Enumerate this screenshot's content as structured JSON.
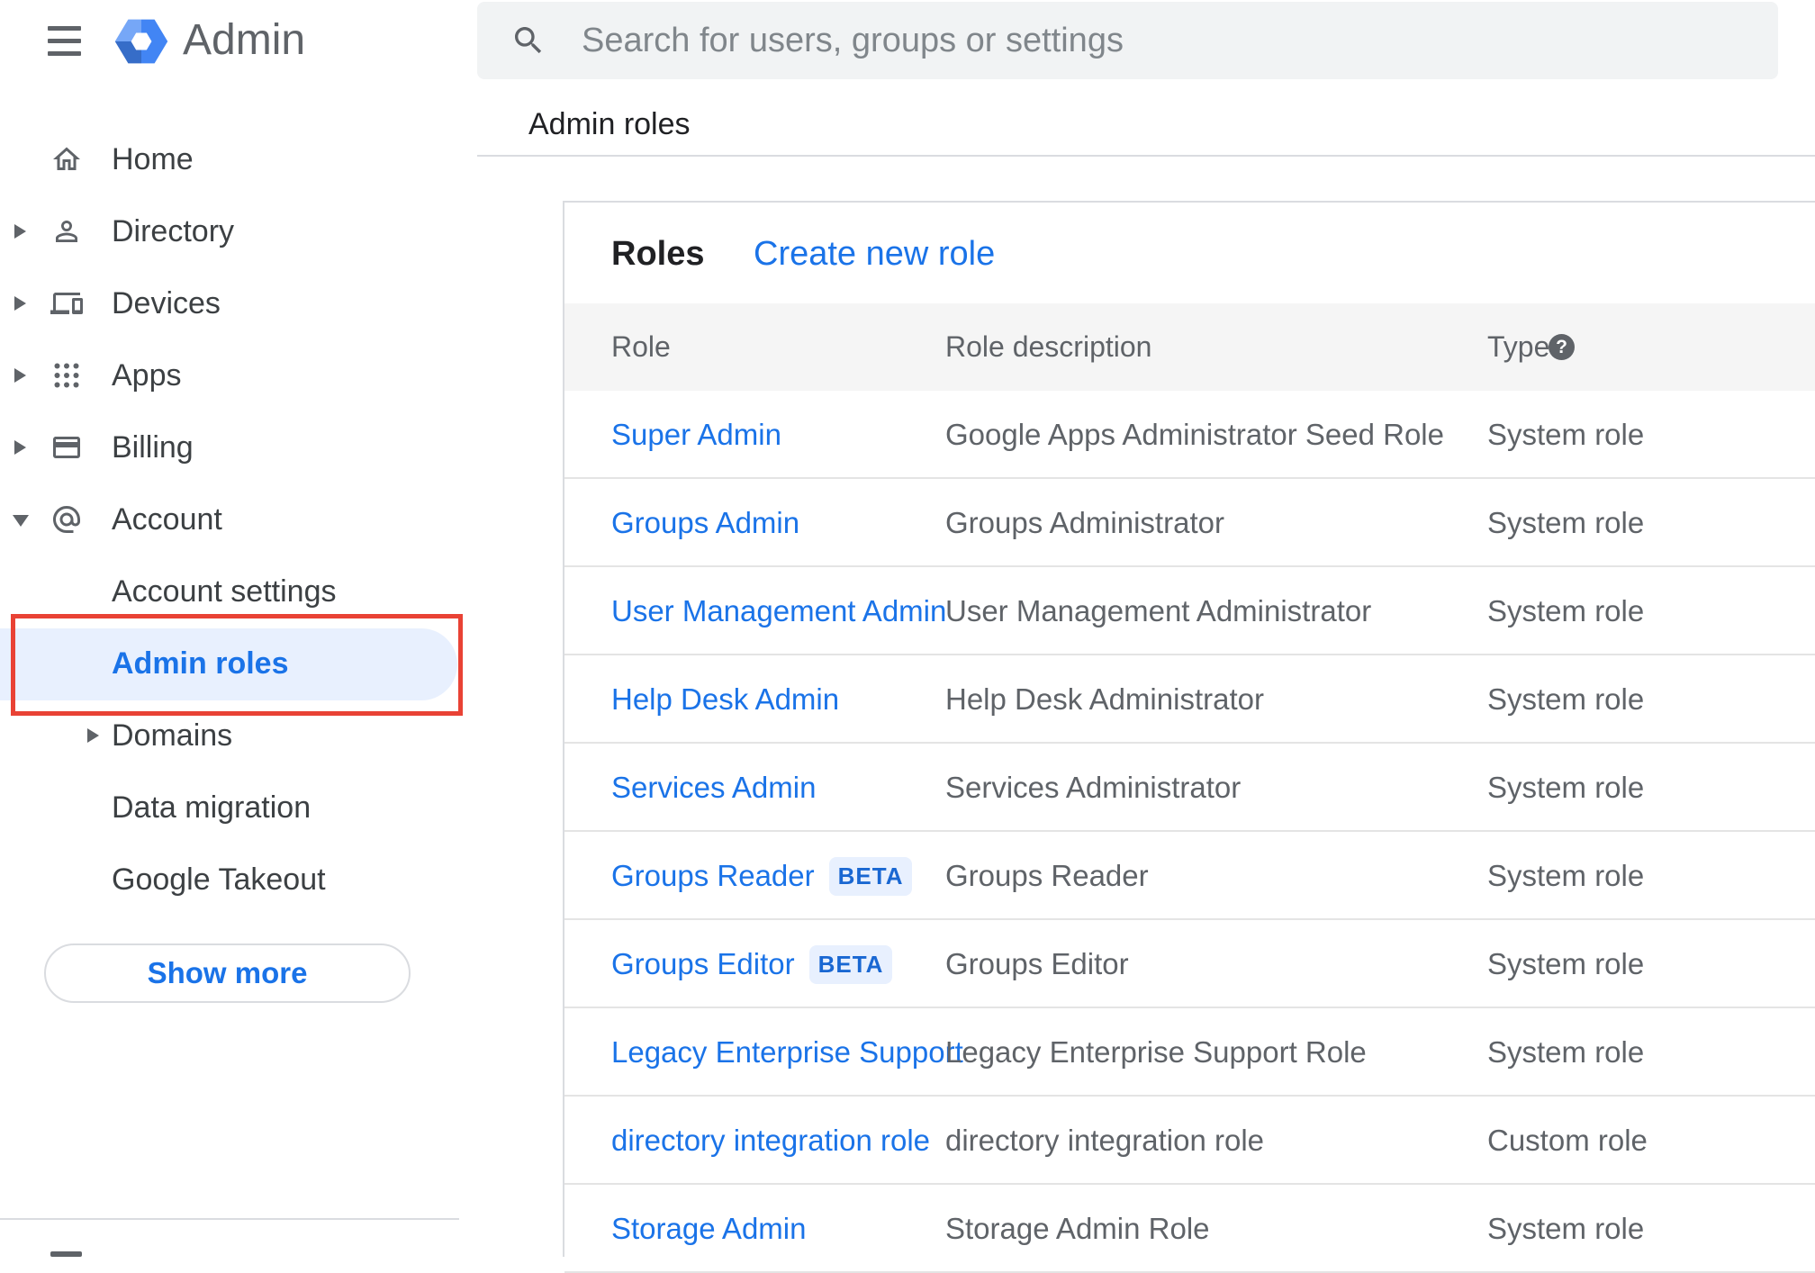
{
  "app": {
    "title": "Admin"
  },
  "search": {
    "placeholder": "Search for users, groups or settings"
  },
  "breadcrumb": "Admin roles",
  "sidebar": {
    "items": [
      {
        "label": "Home"
      },
      {
        "label": "Directory"
      },
      {
        "label": "Devices"
      },
      {
        "label": "Apps"
      },
      {
        "label": "Billing"
      },
      {
        "label": "Account"
      },
      {
        "label": "Account settings"
      },
      {
        "label": "Admin roles"
      },
      {
        "label": "Domains"
      },
      {
        "label": "Data migration"
      },
      {
        "label": "Google Takeout"
      }
    ],
    "show_more_label": "Show more"
  },
  "roles_panel": {
    "title": "Roles",
    "create_link": "Create new role",
    "columns": {
      "role": "Role",
      "description": "Role description",
      "type": "Type",
      "type_help": "?"
    },
    "rows": [
      {
        "role": "Super Admin",
        "description": "Google Apps Administrator Seed Role",
        "type": "System role"
      },
      {
        "role": "Groups Admin",
        "description": "Groups Administrator",
        "type": "System role"
      },
      {
        "role": "User Management Admin",
        "description": "User Management Administrator",
        "type": "System role"
      },
      {
        "role": "Help Desk Admin",
        "description": "Help Desk Administrator",
        "type": "System role"
      },
      {
        "role": "Services Admin",
        "description": "Services Administrator",
        "type": "System role"
      },
      {
        "role": "Groups Reader",
        "badge": "BETA",
        "description": "Groups Reader",
        "type": "System role"
      },
      {
        "role": "Groups Editor",
        "badge": "BETA",
        "description": "Groups Editor",
        "type": "System role"
      },
      {
        "role": "Legacy Enterprise Support",
        "description": "Legacy Enterprise Support Role",
        "type": "System role"
      },
      {
        "role": "directory integration role",
        "description": "directory integration role",
        "type": "Custom role"
      },
      {
        "role": "Storage Admin",
        "description": "Storage Admin Role",
        "type": "System role"
      }
    ]
  },
  "colors": {
    "accent_blue": "#1a73e8",
    "selected_item_bg": "#e8f0fe",
    "annotation_red": "#e94235",
    "icon_gray": "#5f6368",
    "header_row_bg": "#f5f5f5",
    "logo_blue": "#4285f4"
  }
}
